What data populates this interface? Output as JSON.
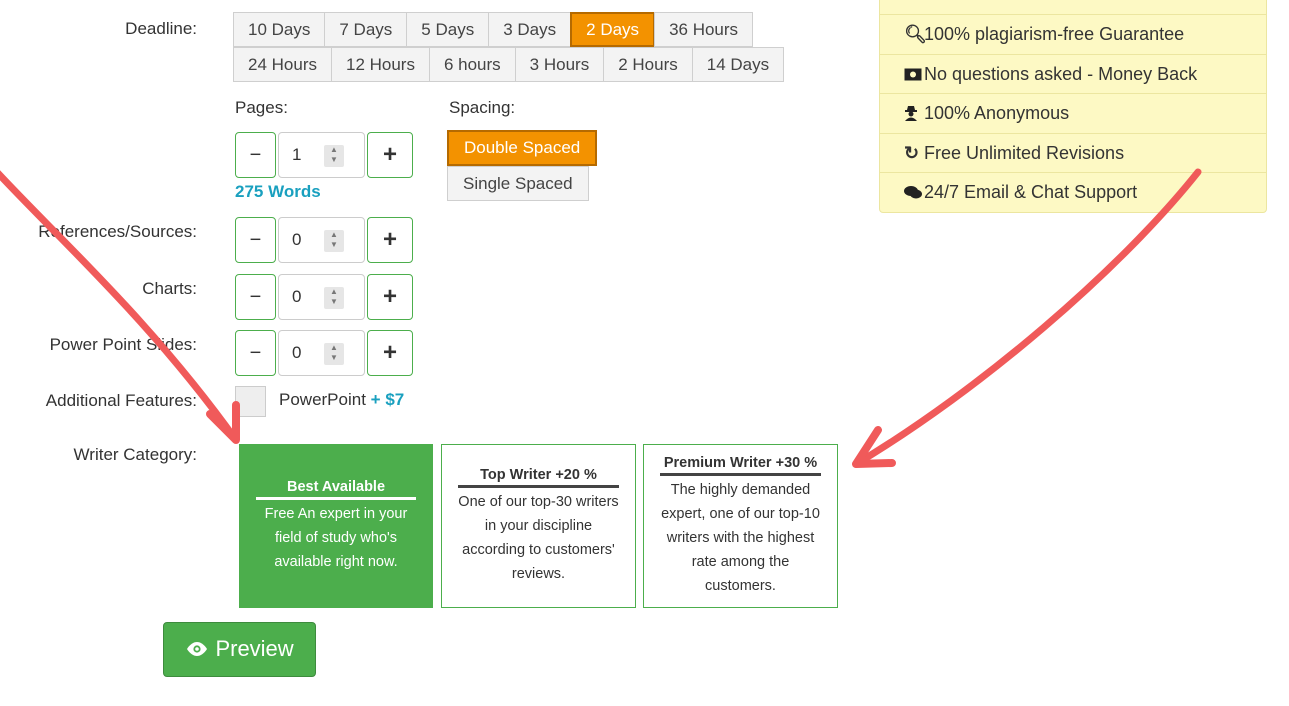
{
  "labels": {
    "deadline": "Deadline:",
    "pages": "Pages:",
    "spacing": "Spacing:",
    "references": "References/Sources:",
    "charts": "Charts:",
    "slides": "Power Point Slides:",
    "additional": "Additional Features:",
    "writer_category": "Writer Category:"
  },
  "deadline": {
    "row1": [
      "10 Days",
      "7 Days",
      "5 Days",
      "3 Days",
      "2 Days",
      "36 Hours"
    ],
    "row2": [
      "24 Hours",
      "12 Hours",
      "6 hours",
      "3 Hours",
      "2 Hours",
      "14 Days"
    ],
    "selected": "2 Days"
  },
  "pages": {
    "value": "1",
    "words": "275 Words"
  },
  "references": {
    "value": "0"
  },
  "charts": {
    "value": "0"
  },
  "slides": {
    "value": "0"
  },
  "stepper": {
    "minus": "−",
    "plus": "+"
  },
  "spacing": {
    "double": "Double Spaced",
    "single": "Single Spaced",
    "selected": "Double Spaced"
  },
  "additional": {
    "name": "PowerPoint",
    "price": "+ $7"
  },
  "writers": [
    {
      "title": "Best Available",
      "desc": "Free An expert in your field of study who's available right now."
    },
    {
      "title": "Top Writer +20 %",
      "desc": "One of our top-30 writers in your discipline according to customers' reviews."
    },
    {
      "title": "Premium Writer +30 %",
      "desc": "The highly demanded expert, one of our top-10 writers with the highest rate among the customers."
    }
  ],
  "preview": {
    "label": "Preview"
  },
  "guarantees": [
    {
      "icon": "search-icon",
      "text": "100% plagiarism-free Guarantee"
    },
    {
      "icon": "money-icon",
      "text": "No questions asked - Money Back"
    },
    {
      "icon": "user-secret-icon",
      "text": "100% Anonymous"
    },
    {
      "icon": "refresh-icon",
      "text": "Free Unlimited Revisions"
    },
    {
      "icon": "comments-icon",
      "text": "24/7 Email & Chat Support"
    }
  ],
  "colors": {
    "accent_orange": "#f39200",
    "accent_green": "#4cae4c",
    "link_blue": "#1aa0bf",
    "panel_yellow": "#fdf9c4",
    "arrow_red": "#f05a5a"
  }
}
